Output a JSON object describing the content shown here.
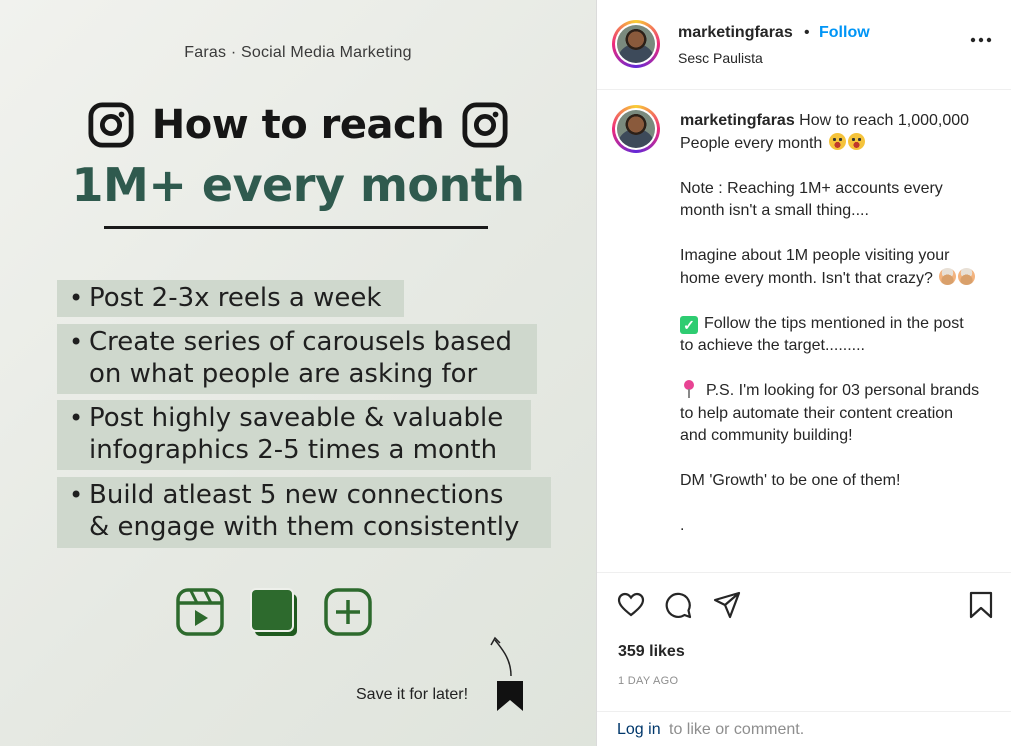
{
  "post_image": {
    "brand_line": "Faras · Social Media Marketing",
    "title_line1": "How to reach",
    "title_line2": "1M+ every month",
    "tips": [
      {
        "line1": "Post 2-3x reels a week",
        "line2": ""
      },
      {
        "line1": "Create series of carousels based",
        "line2": "on what people are asking for"
      },
      {
        "line1": "Post highly saveable & valuable",
        "line2": "infographics 2-5 times a month"
      },
      {
        "line1": "Build atleast 5 new connections",
        "line2": "& engage with them consistently"
      }
    ],
    "bullet": "•",
    "icons": [
      "reels-icon",
      "carousel-icon",
      "add-post-icon"
    ],
    "save_hint": "Save it for later!",
    "accent_color": "#2f5a4e",
    "highlight_color": "#cfd8cd",
    "icon_color": "#2d6a2d"
  },
  "header": {
    "username": "marketingfaras",
    "separator": "•",
    "follow_label": "Follow",
    "location": "Sesc Paulista"
  },
  "caption": {
    "username": "marketingfaras",
    "intro": "How to reach 1,000,000 People every month",
    "note": "Note : Reaching 1M+ accounts every month isn't a small thing....",
    "imagine": "Imagine about 1M people visiting your home every month. Isn't that crazy?",
    "follow_tips": "Follow the tips mentioned in the post to achieve the target.........",
    "ps": "P.S. I'm looking for 03 personal brands to help automate their content creation and community building!",
    "dm": "DM 'Growth' to be one of them!",
    "trailing": "."
  },
  "actions": {
    "likes": "359 likes",
    "time": "1 DAY AGO"
  },
  "login": {
    "link": "Log in",
    "rest": "to like or comment."
  },
  "colors": {
    "follow_blue": "#0095f6",
    "link_blue": "#00376b",
    "muted": "#8e8e8e"
  }
}
